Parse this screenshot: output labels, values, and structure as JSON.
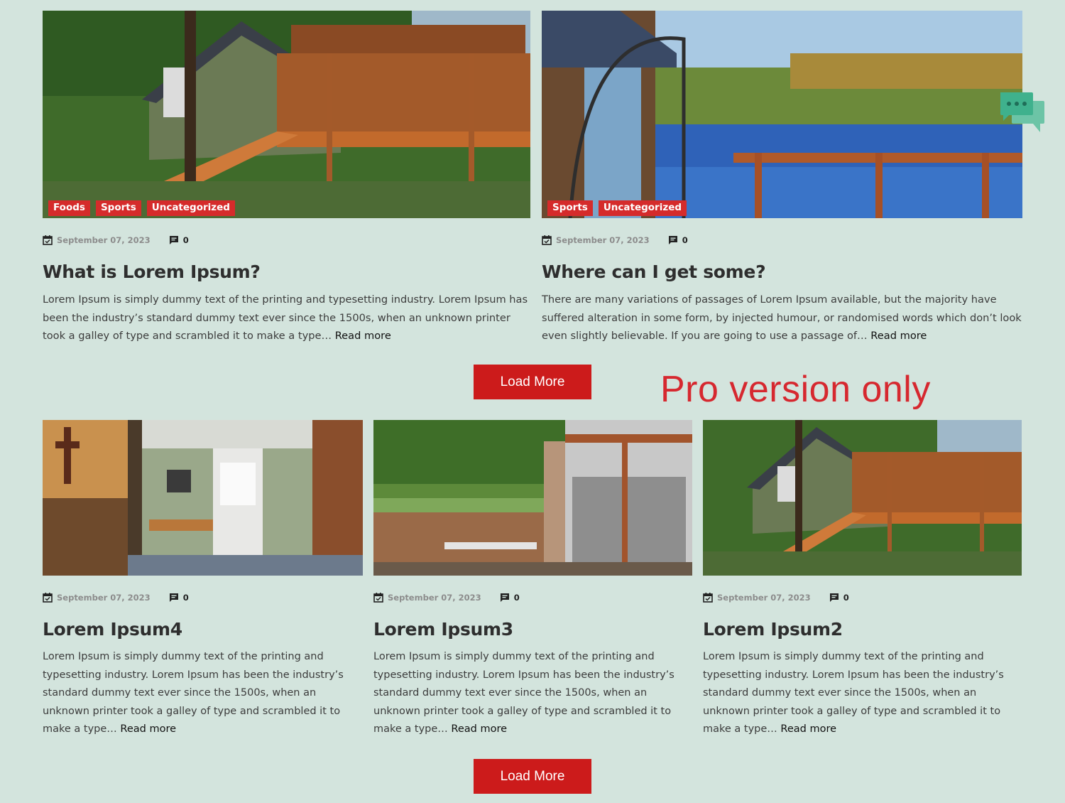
{
  "top_posts": [
    {
      "categories": [
        "Foods",
        "Sports",
        "Uncategorized"
      ],
      "date": "September 07, 2023",
      "comments": "0",
      "title": "What is Lorem Ipsum?",
      "excerpt": "Lorem Ipsum is simply dummy text of the printing and typesetting industry. Lorem Ipsum has been the industry’s standard dummy text ever since the 1500s, when an unknown printer took a galley of type and scrambled it to make a type…",
      "read_more": "Read more",
      "image_icon": "treehouse-photo"
    },
    {
      "categories": [
        "Sports",
        "Uncategorized"
      ],
      "date": "September 07, 2023",
      "comments": "0",
      "title": "Where can I get some?",
      "excerpt": "There are many variations of passages of Lorem Ipsum available, but the majority have suffered alteration in some form, by injected humour, or randomised words which don’t look even slightly believable. If you are going to use a passage of…",
      "read_more": "Read more",
      "image_icon": "lake-view-photo"
    }
  ],
  "bottom_posts": [
    {
      "date": "September 07, 2023",
      "comments": "0",
      "title": "Lorem Ipsum4",
      "excerpt": "Lorem Ipsum is simply dummy text of the printing and typesetting industry. Lorem Ipsum has been the industry’s standard dummy text ever since the 1500s, when an unknown printer took a galley of type and scrambled it to make a type…",
      "read_more": "Read more",
      "image_icon": "interior-room-photo"
    },
    {
      "date": "September 07, 2023",
      "comments": "0",
      "title": "Lorem Ipsum3",
      "excerpt": "Lorem Ipsum is simply dummy text of the printing and typesetting industry. Lorem Ipsum has been the industry’s standard dummy text ever since the 1500s, when an unknown printer took a galley of type and scrambled it to make a type…",
      "read_more": "Read more",
      "image_icon": "patio-photo"
    },
    {
      "date": "September 07, 2023",
      "comments": "0",
      "title": "Lorem Ipsum2",
      "excerpt": "Lorem Ipsum is simply dummy text of the printing and typesetting industry. Lorem Ipsum has been the industry’s standard dummy text ever since the 1500s, when an unknown printer took a galley of type and scrambled it to make a type…",
      "read_more": "Read more",
      "image_icon": "treehouse-photo"
    }
  ],
  "load_more_label": "Load More",
  "pro_label": "Pro version only",
  "colors": {
    "background": "#d3e4dd",
    "accent": "#cc1b1b",
    "category_badge": "#d52b2b",
    "chat_icon": "#5cc0a0"
  },
  "icons": {
    "date": "calendar-check-icon",
    "comments": "comment-icon",
    "chat": "chat-bubbles-icon"
  }
}
